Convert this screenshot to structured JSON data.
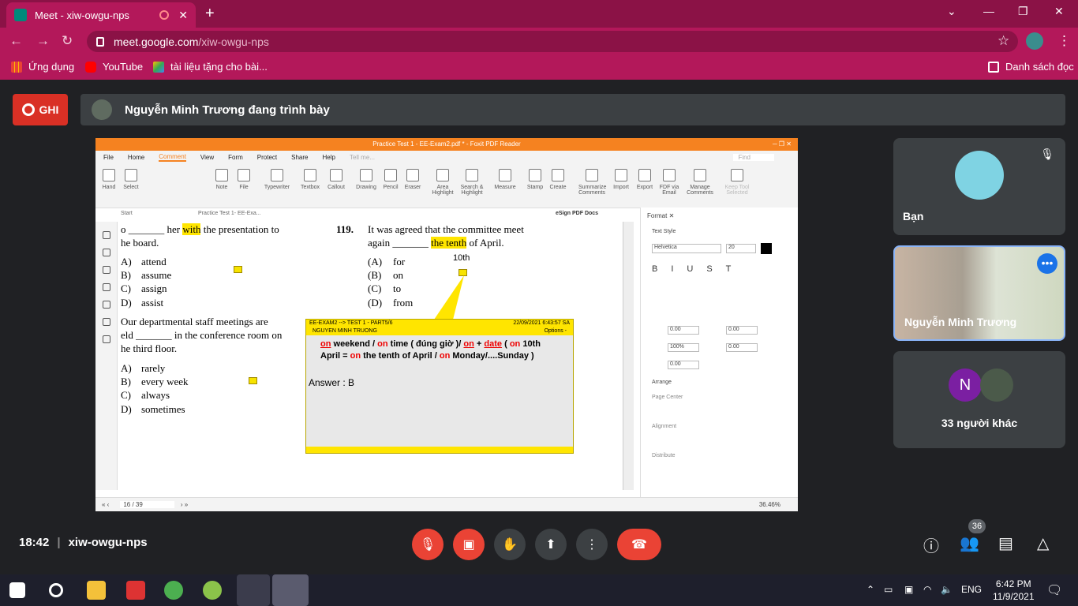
{
  "browser": {
    "tab_title": "Meet - xiw-owgu-nps",
    "url_host": "meet.google.com",
    "url_path": "/xiw-owgu-nps",
    "bookmarks": [
      "Ứng dụng",
      "YouTube",
      "tài liệu tặng cho bài..."
    ],
    "reading_list": "Danh sách đọc"
  },
  "meet": {
    "record_label": "GHI",
    "presenting": "Nguyễn Minh Trương đang trình bày",
    "time": "18:42",
    "meeting_code": "xiw-owgu-nps",
    "participant_count": "36",
    "tiles": [
      {
        "name": "Bạn"
      },
      {
        "name": "Nguyễn Minh Trương"
      },
      {
        "initial": "N",
        "name": "33 người khác"
      }
    ]
  },
  "pdf": {
    "title": "Practice Test 1 - EE-Exam2.pdf * - Foxit PDF Reader",
    "menu": [
      "File",
      "Home",
      "Comment",
      "View",
      "Form",
      "Protect",
      "Share",
      "Help"
    ],
    "tell_me": "Tell me...",
    "find": "Find",
    "tools": [
      "Hand",
      "Select",
      "Note",
      "File",
      "Typewriter",
      "Textbox",
      "Callout",
      "Drawing",
      "Pencil",
      "Eraser",
      "Area Highlight",
      "Search & Highlight",
      "Measure",
      "Stamp",
      "Create",
      "Summarize Comments",
      "Import",
      "Export",
      "FDF via Email",
      "Manage Comments",
      "Keep Tool Selected"
    ],
    "tabs": [
      "Start",
      "Practice Test 1- EE-Exa..."
    ],
    "esign": "eSign PDF Docs",
    "page_indicator": "16 / 39",
    "zoom": "36.46%",
    "left_q": {
      "line1_pre": "o _______ her ",
      "line1_hl": "with",
      "line1_post": " the presentation to",
      "line2": "he board.",
      "options": [
        [
          "A)",
          "attend"
        ],
        [
          "B)",
          "assume"
        ],
        [
          "C)",
          "assign"
        ],
        [
          "D)",
          "assist"
        ]
      ]
    },
    "left_q2": {
      "lines": [
        "Our departmental staff meetings are",
        "eld _______ in the conference room on",
        "he third floor."
      ],
      "options": [
        [
          "A)",
          "rarely"
        ],
        [
          "B)",
          "every week"
        ],
        [
          "C)",
          "always"
        ],
        [
          "D)",
          "sometimes"
        ]
      ]
    },
    "q119": {
      "num": "119.",
      "line1": "It was agreed that the committee meet",
      "line2_pre": "again _______ ",
      "line2_hl": "the tenth",
      "line2_post": " of April.",
      "annot": "10th",
      "options": [
        [
          "(A)",
          "for"
        ],
        [
          "(B)",
          "on"
        ],
        [
          "(C)",
          "to"
        ],
        [
          "(D)",
          "from"
        ]
      ]
    },
    "note": {
      "header_left": "EE-EXAM2 --> TEST 1 - PART5/6",
      "header_right": "22/09/2021 6:43:57 SA",
      "author": "NGUYEN MINH TRUONG",
      "options": "Options -",
      "l1a": "on",
      "l1b": " weekend / ",
      "l1c": "on",
      "l1d": " time ( đúng giờ )/ ",
      "l1e": "on",
      "l1f": " + ",
      "l1g": "date",
      "l1h": " ( ",
      "l1i": "on",
      "l1j": " 10th",
      "l2a": "April = ",
      "l2b": "on",
      "l2c": " the tenth of April / ",
      "l2d": "on",
      "l2e": " Monday/....Sunday )",
      "answer": "Answer : B"
    },
    "format_panel": {
      "tab": "Format",
      "text_style": "Text Style",
      "font": "Helvetica",
      "size": "20",
      "spacing": [
        "0.00",
        "0.00",
        "100%",
        "0.00",
        "0.00"
      ],
      "arrange": "Arrange",
      "page_center": "Page Center",
      "alignment": "Alignment",
      "distribute": "Distribute"
    }
  },
  "taskbar": {
    "lang": "ENG",
    "time": "6:42 PM",
    "date": "11/9/2021"
  }
}
